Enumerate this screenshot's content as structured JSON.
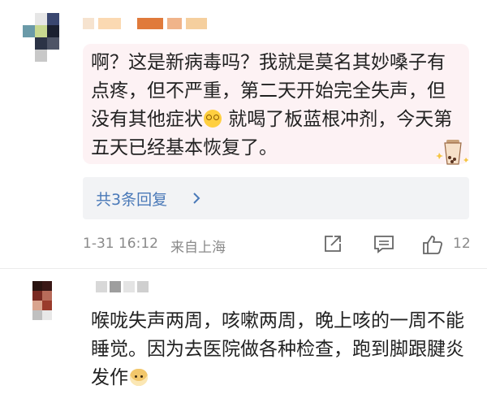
{
  "comments": [
    {
      "text_part1": "啊？这是新病毒吗？我就是莫名其妙嗓子有点疼，但不严重，第二天开始完全失声，但没有其他症状",
      "text_part2": " 就喝了板蓝根冲剂，今天第五天已经基本恢复了。",
      "replies_label": "共3条回复",
      "time": "1-31 16:12",
      "location": "来自上海",
      "like_count": "12",
      "icons": [
        "forward-icon",
        "comment-icon",
        "like-icon",
        "chevron-right-icon",
        "dizzy-face-emoji",
        "bubble-tea-sticker"
      ],
      "colors": {
        "bubble": "#fdf2f4",
        "link": "#4a79b8",
        "meta": "#8a8a8a"
      }
    },
    {
      "text": "喉咙失声两周，咳嗽两周，晚上咳的一周不能睡觉。因为去医院做各种检查，跑到脚跟腱炎发作",
      "icons": [
        "doge-emoji"
      ]
    }
  ]
}
